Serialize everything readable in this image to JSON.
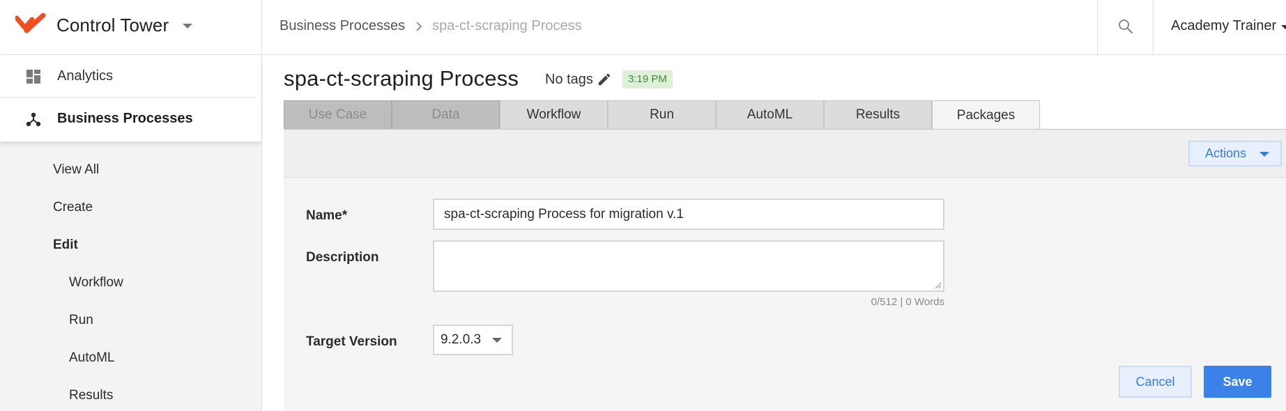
{
  "app": {
    "title": "Control Tower",
    "accent_color": "#f04e23"
  },
  "breadcrumb": {
    "items": [
      "Business Processes",
      "spa-ct-scraping Process"
    ]
  },
  "header": {
    "user_name": "Academy Trainer"
  },
  "sidebar": {
    "items": [
      {
        "label": "Analytics",
        "icon": "dashboard-icon"
      },
      {
        "label": "Business Processes",
        "icon": "process-icon"
      }
    ],
    "sub_items": [
      {
        "label": "View All"
      },
      {
        "label": "Create"
      },
      {
        "label": "Edit"
      },
      {
        "label": "Workflow"
      },
      {
        "label": "Run"
      },
      {
        "label": "AutoML"
      },
      {
        "label": "Results"
      }
    ]
  },
  "main": {
    "title": "spa-ct-scraping Process",
    "tags_label": "No tags",
    "time_badge": "3:19 PM",
    "tabs": [
      {
        "label": "Use Case",
        "state": "disabled"
      },
      {
        "label": "Data",
        "state": "disabled"
      },
      {
        "label": "Workflow",
        "state": "normal"
      },
      {
        "label": "Run",
        "state": "normal"
      },
      {
        "label": "AutoML",
        "state": "normal"
      },
      {
        "label": "Results",
        "state": "normal"
      },
      {
        "label": "Packages",
        "state": "active"
      }
    ],
    "actions_label": "Actions"
  },
  "form": {
    "name_label": "Name*",
    "name_value": "spa-ct-scraping Process for migration v.1",
    "description_label": "Description",
    "description_value": "",
    "counter": "0/512 | 0 Words",
    "target_version_label": "Target Version",
    "target_version_value": "9.2.0.3",
    "cancel_label": "Cancel",
    "save_label": "Save"
  }
}
